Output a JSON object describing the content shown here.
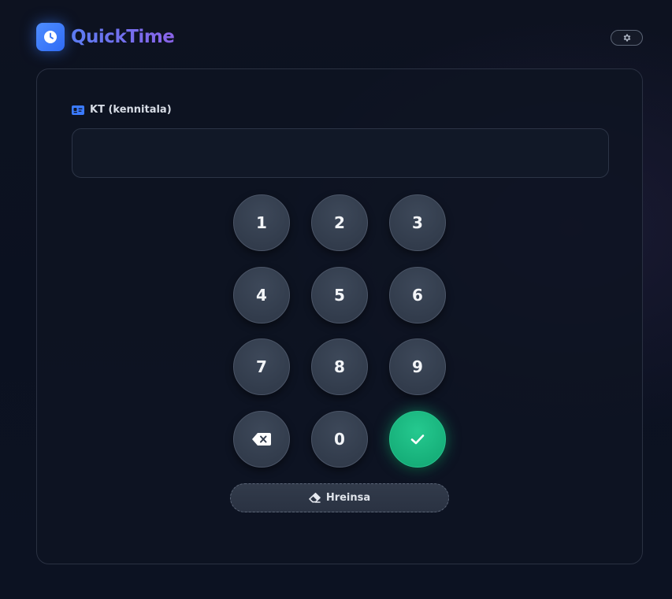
{
  "header": {
    "app_name": "QuickTime",
    "logo_icon": "clock-icon",
    "settings_icon": "gear-icon"
  },
  "form": {
    "label": "KT (kennitala)",
    "label_icon": "id-card-icon",
    "input_value": "",
    "input_placeholder": ""
  },
  "keypad": {
    "keys": [
      "1",
      "2",
      "3",
      "4",
      "5",
      "6",
      "7",
      "8",
      "9"
    ],
    "zero": "0",
    "backspace_icon": "backspace-icon",
    "confirm_icon": "check-icon"
  },
  "clear_button": {
    "label": "Hreinsa",
    "icon": "eraser-icon"
  },
  "colors": {
    "accent": "#3b7bff",
    "confirm": "#1bb981",
    "background": "#0b1120"
  }
}
